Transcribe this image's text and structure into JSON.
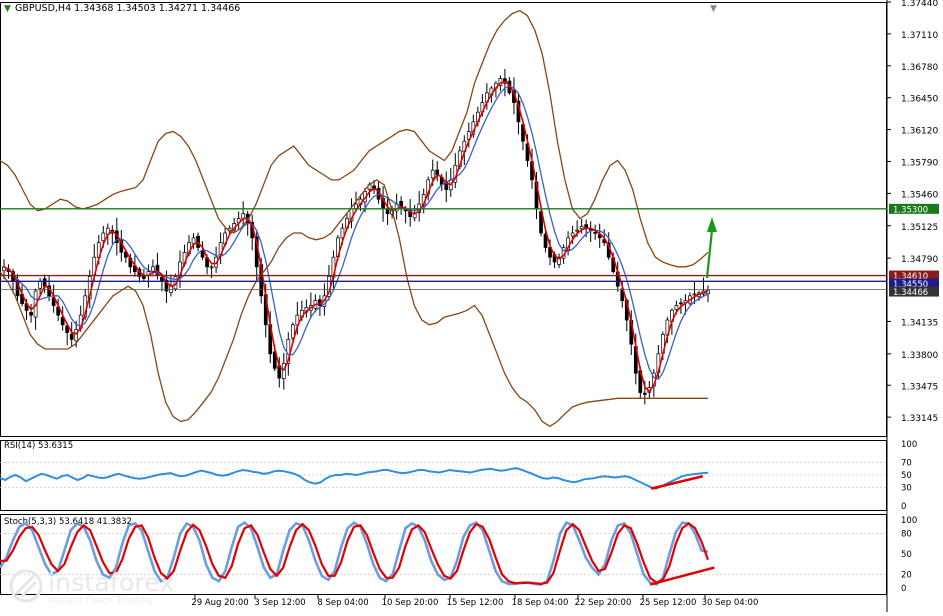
{
  "header": {
    "symbol_line": "GBPUSD,H4  1.34368 1.34503 1.34271 1.34466",
    "arrow_glyph": "▼"
  },
  "colors": {
    "price": "#000000",
    "bollinger": "#8b4513",
    "ma_fast": "#e00000",
    "ma_slow": "#3a5fcd",
    "level_green": "#1a7a1a",
    "level_navy": "#1c1c8c",
    "level_brown": "#8b1a1a",
    "current_price": "#555555",
    "rsi": "#2f8fdf",
    "stoch_main": "#6a9ee0",
    "stoch_signal": "#e00000",
    "annotation": "#e00000",
    "arrow": "#1a9a1a"
  },
  "chart_data": [
    {
      "type": "candlestick",
      "title": "GBPUSD,H4",
      "ohlc_header": {
        "open": 1.34368,
        "high": 1.34503,
        "low": 1.34271,
        "close": 1.34466
      },
      "ylim": [
        1.3295,
        1.3744
      ],
      "y_ticks": [
        "1.37440",
        "1.37110",
        "1.36780",
        "1.36450",
        "1.36120",
        "1.35790",
        "1.35460",
        "1.35125",
        "1.34790",
        "1.34135",
        "1.33800",
        "1.33475",
        "1.33145"
      ],
      "x_labels": [
        "29 Aug 20:00",
        "3 Sep 12:00",
        "8 Sep 04:00",
        "10 Sep 20:00",
        "15 Sep 12:00",
        "18 Sep 04:00",
        "22 Sep 20:00",
        "25 Sep 12:00",
        "30 Sep 04:00"
      ],
      "levels": [
        {
          "value": 1.353,
          "label": "1.35300",
          "color": "#1a7a1a",
          "label_bg": "#1a7a1a"
        },
        {
          "value": 1.3461,
          "label": "1.34610",
          "color": "#8b1a1a",
          "label_bg": "#8b1a1a"
        },
        {
          "value": 1.3455,
          "label": "1.34550",
          "color": "#1c1c8c",
          "label_bg": "#1c1c8c"
        },
        {
          "value": 1.34466,
          "label": "1.34466",
          "color": "#555555",
          "label_bg": "#333333"
        }
      ],
      "close_path": [
        1.347,
        1.3465,
        1.3455,
        1.344,
        1.3432,
        1.3425,
        1.342,
        1.3445,
        1.3455,
        1.345,
        1.344,
        1.343,
        1.342,
        1.341,
        1.3402,
        1.3395,
        1.3405,
        1.342,
        1.344,
        1.346,
        1.348,
        1.3495,
        1.3505,
        1.351,
        1.3505,
        1.3495,
        1.3485,
        1.348,
        1.347,
        1.3465,
        1.346,
        1.3458,
        1.3465,
        1.347,
        1.3462,
        1.3455,
        1.3445,
        1.345,
        1.346,
        1.3475,
        1.3485,
        1.3495,
        1.35,
        1.349,
        1.348,
        1.347,
        1.347,
        1.348,
        1.3495,
        1.3505,
        1.351,
        1.3515,
        1.352,
        1.3525,
        1.3515,
        1.35,
        1.347,
        1.344,
        1.341,
        1.338,
        1.3365,
        1.3355,
        1.337,
        1.3395,
        1.341,
        1.342,
        1.3425,
        1.3428,
        1.343,
        1.3435,
        1.343,
        1.344,
        1.346,
        1.348,
        1.35,
        1.351,
        1.352,
        1.353,
        1.3535,
        1.354,
        1.3548,
        1.3555,
        1.355,
        1.354,
        1.353,
        1.3525,
        1.353,
        1.3535,
        1.353,
        1.3528,
        1.3522,
        1.3525,
        1.3535,
        1.3545,
        1.356,
        1.357,
        1.3565,
        1.3555,
        1.355,
        1.356,
        1.3575,
        1.359,
        1.36,
        1.361,
        1.362,
        1.363,
        1.364,
        1.365,
        1.3655,
        1.366,
        1.3665,
        1.366,
        1.365,
        1.364,
        1.362,
        1.36,
        1.358,
        1.356,
        1.353,
        1.3505,
        1.349,
        1.348,
        1.3475,
        1.348,
        1.349,
        1.35,
        1.3505,
        1.3508,
        1.3512,
        1.351,
        1.3508,
        1.3505,
        1.35,
        1.3495,
        1.348,
        1.3465,
        1.345,
        1.3435,
        1.3415,
        1.339,
        1.336,
        1.334,
        1.3338,
        1.3345,
        1.336,
        1.338,
        1.34,
        1.3415,
        1.3425,
        1.343,
        1.3432,
        1.3435,
        1.344,
        1.3442,
        1.3443,
        1.3445,
        1.3446
      ],
      "bollinger_upper": [
        1.358,
        1.3575,
        1.3565,
        1.355,
        1.3535,
        1.3528,
        1.353,
        1.3535,
        1.354,
        1.3538,
        1.3532,
        1.353,
        1.3532,
        1.3535,
        1.354,
        1.3545,
        1.3548,
        1.355,
        1.3552,
        1.356,
        1.358,
        1.36,
        1.3608,
        1.361,
        1.3605,
        1.3595,
        1.358,
        1.356,
        1.354,
        1.352,
        1.351,
        1.3505,
        1.351,
        1.352,
        1.3535,
        1.3555,
        1.3575,
        1.3585,
        1.359,
        1.3595,
        1.3585,
        1.3575,
        1.357,
        1.3565,
        1.356,
        1.356,
        1.3565,
        1.357,
        1.358,
        1.359,
        1.3595,
        1.36,
        1.3605,
        1.361,
        1.3612,
        1.361,
        1.36,
        1.359,
        1.3585,
        1.358,
        1.359,
        1.361,
        1.363,
        1.366,
        1.368,
        1.37,
        1.3715,
        1.3725,
        1.3732,
        1.3735,
        1.373,
        1.3715,
        1.369,
        1.365,
        1.36,
        1.356,
        1.353,
        1.352,
        1.3525,
        1.354,
        1.356,
        1.3575,
        1.358,
        1.357,
        1.355,
        1.352,
        1.3495,
        1.348,
        1.3475,
        1.3472,
        1.347,
        1.347,
        1.3472,
        1.3478,
        1.3485
      ],
      "bollinger_lower": [
        1.3465,
        1.3455,
        1.344,
        1.342,
        1.34,
        1.339,
        1.3385,
        1.3385,
        1.3385,
        1.3385,
        1.339,
        1.34,
        1.341,
        1.342,
        1.343,
        1.344,
        1.3445,
        1.345,
        1.3445,
        1.343,
        1.34,
        1.336,
        1.333,
        1.3315,
        1.331,
        1.3312,
        1.332,
        1.333,
        1.334,
        1.3355,
        1.3375,
        1.3395,
        1.342,
        1.344,
        1.3455,
        1.3465,
        1.3475,
        1.349,
        1.35,
        1.3505,
        1.3505,
        1.35,
        1.3498,
        1.35,
        1.3505,
        1.3515,
        1.3525,
        1.3535,
        1.3545,
        1.3555,
        1.356,
        1.3555,
        1.353,
        1.35,
        1.346,
        1.343,
        1.3415,
        1.341,
        1.3412,
        1.3418,
        1.342,
        1.3422,
        1.3425,
        1.343,
        1.342,
        1.34,
        1.338,
        1.336,
        1.3345,
        1.3335,
        1.333,
        1.3322,
        1.331,
        1.3305,
        1.331,
        1.3318,
        1.3325,
        1.3328,
        1.333,
        1.3331,
        1.3332,
        1.3333,
        1.3334,
        1.3334,
        1.3334,
        1.3334,
        1.3334,
        1.3334,
        1.3334,
        1.3334,
        1.3334,
        1.3334,
        1.3334,
        1.3334,
        1.3334
      ]
    },
    {
      "type": "line",
      "title": "RSI(14) 53.6315",
      "ylim": [
        0,
        100
      ],
      "y_ticks": [
        "100",
        "70",
        "50",
        "30",
        "0"
      ],
      "reference_lines": [
        70,
        50,
        30
      ],
      "values": [
        45,
        42,
        47,
        50,
        46,
        40,
        44,
        48,
        52,
        50,
        47,
        44,
        48,
        50,
        46,
        42,
        45,
        50,
        48,
        46,
        45,
        47,
        50,
        52,
        49,
        47,
        45,
        44,
        45,
        47,
        49,
        51,
        52,
        53,
        50,
        48,
        49,
        52,
        55,
        57,
        55,
        53,
        50,
        49,
        50,
        53,
        56,
        58,
        57,
        55,
        54,
        52,
        53,
        56,
        57,
        56,
        54,
        52,
        48,
        42,
        38,
        36,
        38,
        44,
        48,
        50,
        50,
        52,
        51,
        50,
        52,
        54,
        55,
        56,
        58,
        58,
        56,
        54,
        53,
        54,
        56,
        58,
        58,
        56,
        55,
        54,
        56,
        58,
        57,
        56,
        55,
        54,
        56,
        58,
        59,
        60,
        58,
        57,
        58,
        60,
        61,
        58,
        55,
        52,
        48,
        45,
        44,
        46,
        45,
        42,
        40,
        38,
        40,
        43,
        44,
        45,
        47,
        48,
        47,
        46,
        47,
        48,
        46,
        42,
        38,
        34,
        30,
        28,
        32,
        36,
        40,
        44,
        48,
        50,
        51,
        52,
        53,
        53.6
      ],
      "annotation": {
        "from": [
          126,
          28
        ],
        "to": [
          136,
          48
        ]
      }
    },
    {
      "type": "line",
      "title": "Stoch(5,3,3) 53.6418 41.3832",
      "ylim": [
        0,
        100
      ],
      "y_ticks": [
        "100",
        "80",
        "50",
        "20",
        "0"
      ],
      "reference_lines": [
        80,
        20
      ],
      "series": [
        {
          "name": "Stoch",
          "values": [
            30,
            45,
            70,
            90,
            95,
            85,
            60,
            35,
            20,
            25,
            55,
            85,
            95,
            90,
            70,
            40,
            20,
            15,
            30,
            65,
            92,
            95,
            85,
            55,
            25,
            10,
            15,
            45,
            80,
            95,
            90,
            70,
            35,
            15,
            10,
            25,
            60,
            90,
            96,
            88,
            60,
            30,
            15,
            20,
            55,
            85,
            95,
            92,
            70,
            40,
            18,
            12,
            25,
            60,
            88,
            96,
            90,
            65,
            35,
            15,
            10,
            20,
            55,
            88,
            95,
            90,
            70,
            40,
            20,
            12,
            15,
            40,
            75,
            92,
            96,
            85,
            55,
            25,
            10,
            6,
            6,
            8,
            8,
            6,
            5,
            10,
            40,
            80,
            96,
            92,
            70,
            45,
            30,
            20,
            35,
            70,
            92,
            95,
            80,
            50,
            20,
            8,
            5,
            15,
            50,
            82,
            96,
            95,
            80,
            55,
            53.6
          ]
        },
        {
          "name": "Signal",
          "values": [
            40,
            40,
            55,
            75,
            88,
            90,
            78,
            55,
            35,
            25,
            35,
            60,
            82,
            92,
            85,
            62,
            38,
            22,
            22,
            42,
            72,
            90,
            92,
            75,
            45,
            22,
            14,
            25,
            55,
            82,
            93,
            85,
            62,
            35,
            18,
            15,
            32,
            65,
            88,
            92,
            78,
            52,
            28,
            18,
            30,
            60,
            85,
            94,
            85,
            62,
            35,
            18,
            18,
            38,
            70,
            90,
            92,
            78,
            52,
            28,
            15,
            15,
            30,
            62,
            86,
            92,
            82,
            58,
            35,
            18,
            14,
            25,
            55,
            82,
            94,
            90,
            72,
            45,
            20,
            10,
            7,
            7,
            8,
            7,
            6,
            8,
            22,
            55,
            85,
            94,
            85,
            62,
            40,
            25,
            28,
            52,
            80,
            92,
            88,
            65,
            38,
            15,
            8,
            12,
            32,
            65,
            88,
            95,
            88,
            68,
            41.4
          ]
        }
      ],
      "annotation": {
        "from": [
          101,
          5
        ],
        "to": [
          111,
          30
        ]
      }
    }
  ],
  "watermark": {
    "brand": "instaforex",
    "tagline": "Instant Forex Trading"
  }
}
